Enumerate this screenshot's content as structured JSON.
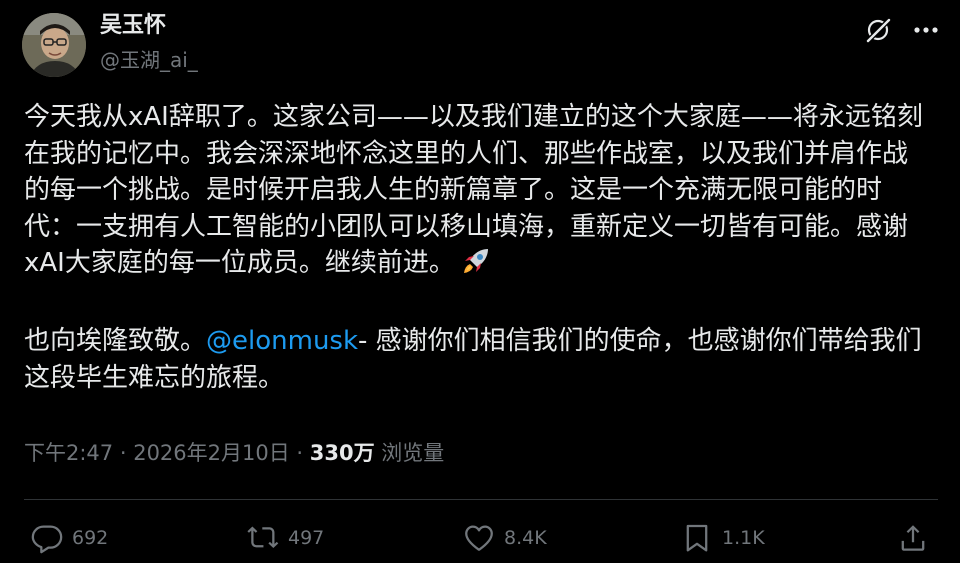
{
  "author": {
    "display_name": "吴玉怀",
    "handle": "@玉湖_ai_"
  },
  "body": {
    "paragraph1": "今天我从xAI辞职了。这家公司——以及我们建立的这个大家庭——将永远铭刻在我的记忆中。我会深深地怀念这里的人们、那些作战室，以及我们并肩作战的每一个挑战。是时候开启我人生的新篇章了。这是一个充满无限可能的时代：一支拥有人工智能的小团队可以移山填海，重新定义一切皆有可能。感谢xAI大家庭的每一位成员。继续前进。",
    "paragraph1_emoji": "rocket-emoji",
    "paragraph2_before": "也向埃隆致敬。",
    "paragraph2_mention": "@elonmusk",
    "paragraph2_after": "- 感谢你们相信我们的使命，也感谢你们带给我们这段毕生难忘的旅程。"
  },
  "meta": {
    "time": "下午2:47",
    "separator1": " · ",
    "date": "2026年2月10日",
    "separator2": " · ",
    "views_count": "330万",
    "views_label": " 浏览量"
  },
  "actions": {
    "replies": "692",
    "reposts": "497",
    "likes": "8.4K",
    "bookmarks": "1.1K"
  },
  "colors": {
    "background": "#000000",
    "text": "#e7e9ea",
    "secondary": "#71767b",
    "accent": "#1d9bf0",
    "divider": "#2f3336"
  },
  "icons": {
    "grok": "grok-icon",
    "more": "more-icon",
    "reply": "reply-icon",
    "repost": "repost-icon",
    "like": "heart-icon",
    "bookmark": "bookmark-icon",
    "share": "share-icon"
  }
}
